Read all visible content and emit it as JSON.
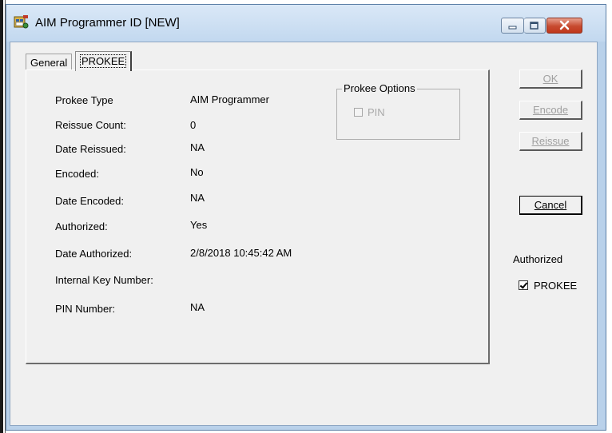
{
  "window": {
    "title": "AIM Programmer ID  [NEW]",
    "icon": "keys-app-icon"
  },
  "tabs": [
    {
      "label": "General",
      "active": false
    },
    {
      "label": "PROKEE",
      "active": true
    }
  ],
  "fields": [
    {
      "label": "Prokee Type",
      "value": "AIM Programmer"
    },
    {
      "label": "Reissue Count:",
      "value": "0"
    },
    {
      "label": "Date Reissued:",
      "value": "NA"
    },
    {
      "label": "Encoded:",
      "value": "No"
    },
    {
      "label": "Date Encoded:",
      "value": "NA"
    },
    {
      "label": "Authorized:",
      "value": "Yes"
    },
    {
      "label": "Date Authorized:",
      "value": "2/8/2018 10:45:42 AM"
    },
    {
      "label": "Internal Key Number:",
      "value": ""
    },
    {
      "label": "PIN Number:",
      "value": "NA"
    }
  ],
  "prokee_options": {
    "title": "Prokee Options",
    "pin_label": "PIN",
    "pin_checked": false,
    "pin_enabled": false
  },
  "buttons": {
    "ok": {
      "label": "OK",
      "enabled": false
    },
    "encode": {
      "label": "Encode",
      "enabled": false
    },
    "reissue": {
      "label": "Reissue",
      "enabled": false
    },
    "cancel": {
      "label": "Cancel",
      "enabled": true
    }
  },
  "authorized": {
    "title": "Authorized",
    "prokee_label": "PROKEE",
    "prokee_checked": true
  }
}
